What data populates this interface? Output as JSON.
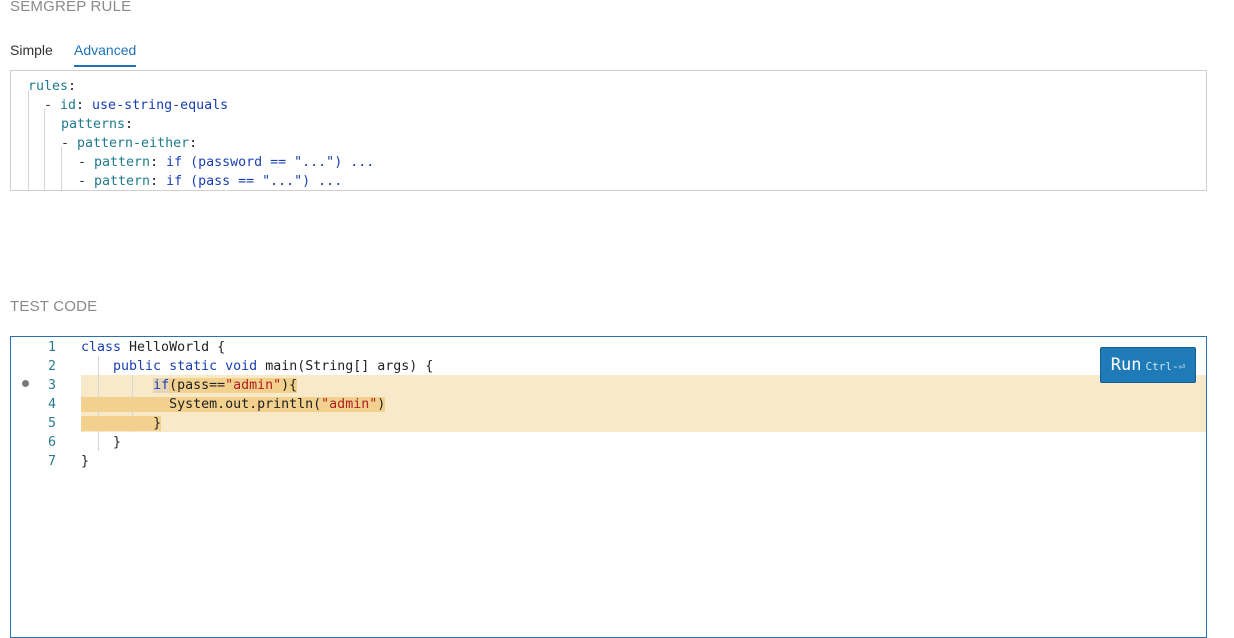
{
  "rule_section": {
    "title": "SEMGREP RULE",
    "tabs": [
      {
        "label": "Simple"
      },
      {
        "label": "Advanced"
      }
    ],
    "active_tab": "Advanced",
    "yaml": {
      "l1_key": "rules",
      "l2_key": "id",
      "l2_val": "use-string-equals",
      "l3_key": "patterns",
      "l4_key": "pattern-either",
      "l5_key": "pattern",
      "l5_val": "if (password == \"...\") ...",
      "l6_key": "pattern",
      "l6_val": "if (pass == \"...\") ..."
    }
  },
  "test_section": {
    "title": "TEST CODE",
    "line_numbers": [
      "1",
      "2",
      "3",
      "4",
      "5",
      "6",
      "7"
    ],
    "code": {
      "l1_kw": "class",
      "l1_rest": " HelloWorld {",
      "l2_kw1": "public",
      "l2_kw2": "static",
      "l2_kw3": "void",
      "l2_rest": " main(String[] args) {",
      "l3_kw": "if",
      "l3_a": "(pass==",
      "l3_str": "\"admin\"",
      "l3_b": "){",
      "l4_a": "System.out.println(",
      "l4_str": "\"admin\"",
      "l4_b": ")",
      "l5": "}",
      "l6": "}",
      "l7": "}"
    },
    "run_button": {
      "label": "Run",
      "shortcut": "Ctrl-⏎"
    },
    "colors": {
      "highlight_band": "#f8e9c8",
      "match_mark": "#f2d08e",
      "accent": "#1f7ab8"
    }
  }
}
